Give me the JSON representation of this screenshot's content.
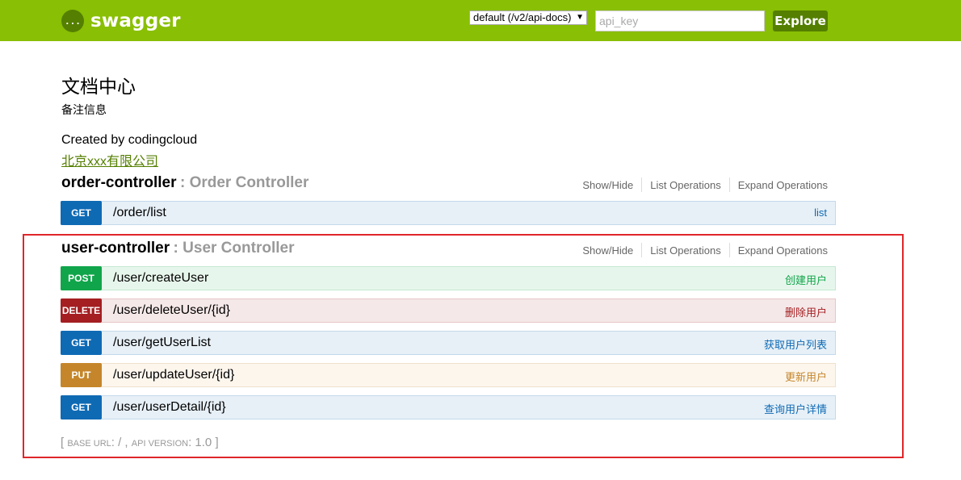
{
  "header": {
    "logo_text": "swagger",
    "logo_icon": "{...}",
    "spec_select_value": "default (/v2/api-docs)",
    "api_key_placeholder": "api_key",
    "explore_label": "Explore"
  },
  "info": {
    "title": "文档中心",
    "description": "备注信息",
    "created_by": "Created by codingcloud",
    "contact_link": "北京xxx有限公司"
  },
  "resources": [
    {
      "name": "order-controller",
      "description": ": Order Controller",
      "actions": {
        "show_hide": "Show/Hide",
        "list": "List Operations",
        "expand": "Expand Operations"
      },
      "operations": [
        {
          "method": "GET",
          "path": "/order/list",
          "summary": "list"
        }
      ]
    },
    {
      "name": "user-controller",
      "description": ": User Controller",
      "actions": {
        "show_hide": "Show/Hide",
        "list": "List Operations",
        "expand": "Expand Operations"
      },
      "operations": [
        {
          "method": "POST",
          "path": "/user/createUser",
          "summary": "创建用户"
        },
        {
          "method": "DELETE",
          "path": "/user/deleteUser/{id}",
          "summary": "删除用户"
        },
        {
          "method": "GET",
          "path": "/user/getUserList",
          "summary": "获取用户列表"
        },
        {
          "method": "PUT",
          "path": "/user/updateUser/{id}",
          "summary": "更新用户"
        },
        {
          "method": "GET",
          "path": "/user/userDetail/{id}",
          "summary": "查询用户详情"
        }
      ]
    }
  ],
  "footer": {
    "open_bracket": "[",
    "base_url_label": "base url",
    "base_url_value": ": / ,",
    "api_version_label": "api version",
    "api_version_value": ": 1.0",
    "close_bracket": "]"
  },
  "colors": {
    "header_bg": "#89bf04",
    "brand_dark": "#547f00",
    "get": "#0f6ab4",
    "post": "#10a54a",
    "delete": "#a41e22",
    "put": "#c5862b",
    "highlight": "#e0262a"
  }
}
